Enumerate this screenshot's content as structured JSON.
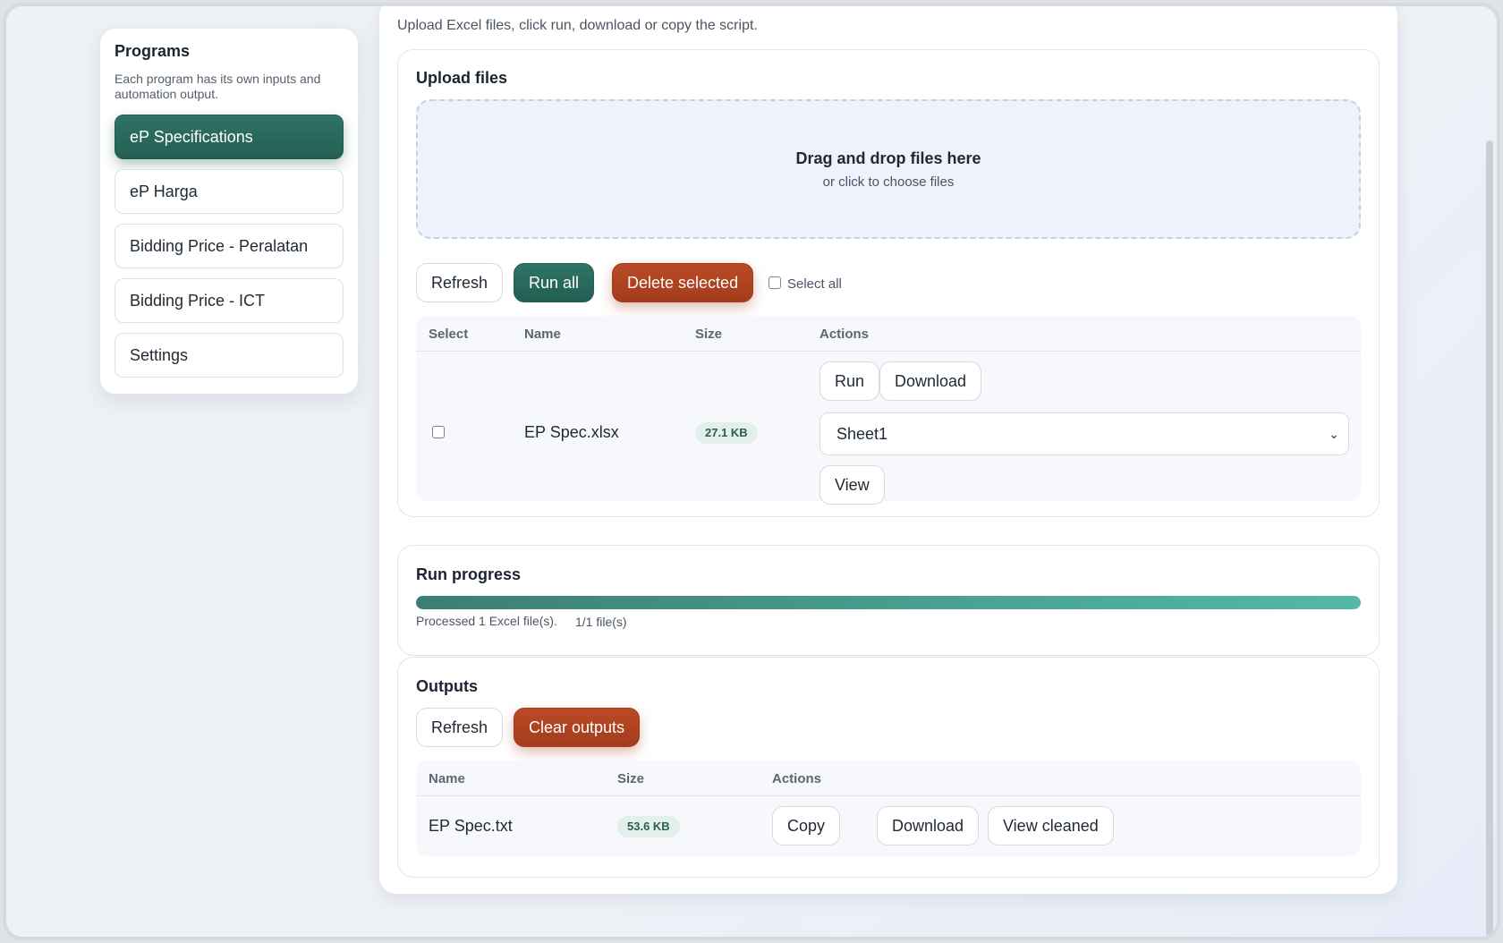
{
  "sidebar": {
    "title": "Programs",
    "description": "Each program has its own inputs and automation output.",
    "items": [
      {
        "label": "eP Specifications",
        "active": true
      },
      {
        "label": "eP Harga",
        "active": false
      },
      {
        "label": "Bidding Price - Peralatan",
        "active": false
      },
      {
        "label": "Bidding Price - ICT",
        "active": false
      },
      {
        "label": "Settings",
        "active": false
      }
    ]
  },
  "main": {
    "subtitle": "Upload Excel files, click run, download or copy the script."
  },
  "upload": {
    "title": "Upload files",
    "dropzone_title": "Drag and drop files here",
    "dropzone_sub": "or click to choose files",
    "refresh_label": "Refresh",
    "run_all_label": "Run all",
    "delete_selected_label": "Delete selected",
    "select_all_label": "Select all",
    "columns": [
      "Select",
      "Name",
      "Size",
      "Actions"
    ],
    "rows": [
      {
        "name": "EP Spec.xlsx",
        "size": "27.1 KB",
        "run_label": "Run",
        "download_label": "Download",
        "sheet": "Sheet1",
        "view_label": "View"
      }
    ]
  },
  "progress": {
    "title": "Run progress",
    "status": "Processed 1 Excel file(s).",
    "count": "1/1 file(s)",
    "fraction": 1.0
  },
  "outputs": {
    "title": "Outputs",
    "refresh_label": "Refresh",
    "clear_label": "Clear outputs",
    "columns": [
      "Name",
      "Size",
      "Actions"
    ],
    "rows": [
      {
        "name": "EP Spec.txt",
        "size": "53.6 KB",
        "copy_label": "Copy",
        "download_label": "Download",
        "view_cleaned_label": "View cleaned"
      }
    ]
  },
  "colors": {
    "accent_teal": "#245e53",
    "danger_orange": "#a33c1c",
    "dropzone_bg": "#eef2fc"
  }
}
